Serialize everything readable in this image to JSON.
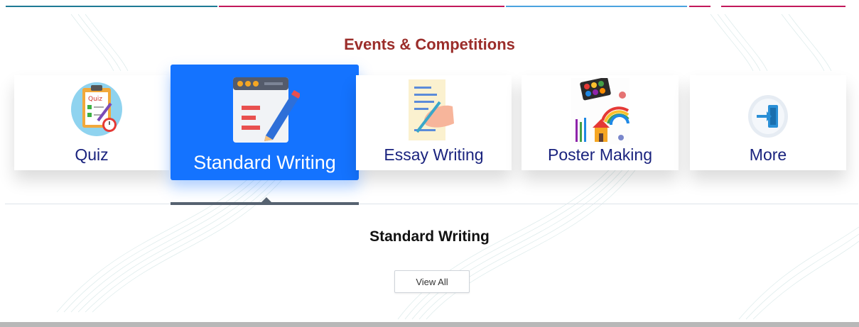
{
  "section": {
    "title": "Events & Competitions"
  },
  "categories": [
    {
      "label": "Quiz",
      "icon": "quiz-clipboard-icon",
      "active": false
    },
    {
      "label": "Standard Writing",
      "icon": "writing-document-icon",
      "active": true
    },
    {
      "label": "Essay Writing",
      "icon": "essay-hand-writing-icon",
      "active": false
    },
    {
      "label": "Poster Making",
      "icon": "art-palette-icon",
      "active": false
    },
    {
      "label": "More",
      "icon": "exit-door-icon",
      "active": false
    }
  ],
  "panel": {
    "title": "Standard Writing",
    "view_all_label": "View All"
  },
  "colors": {
    "title": "#9b2d2a",
    "card_label": "#1a237e",
    "active_card": "#1473ff",
    "tab_indicator": "#566270",
    "top_accent_teal": "#1e7a95",
    "top_accent_magenta": "#c2185b",
    "top_accent_blue": "#4aa3df"
  }
}
